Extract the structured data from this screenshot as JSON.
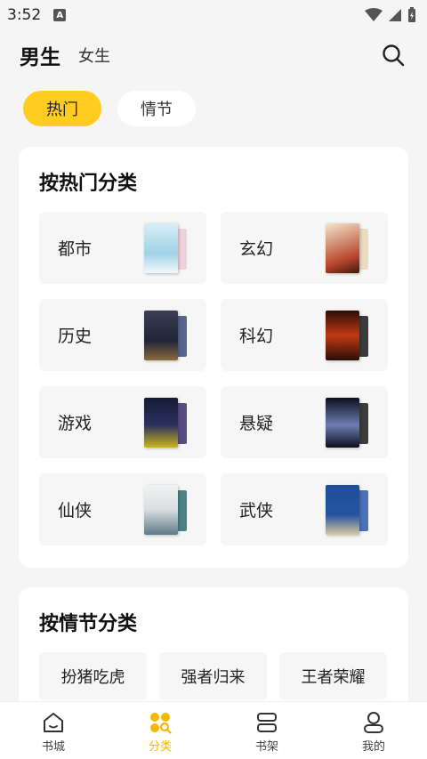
{
  "status_bar": {
    "time": "3:52",
    "notification_letter": "A"
  },
  "header": {
    "tab_male": "男生",
    "tab_female": "女生",
    "search_icon": "search-icon"
  },
  "filters": [
    {
      "label": "热门",
      "active": true
    },
    {
      "label": "情节",
      "active": false
    }
  ],
  "hot_section": {
    "title": "按热门分类",
    "categories": [
      {
        "label": "都市",
        "cover_colors": [
          "#9fd3e6",
          "#f1c9d6"
        ]
      },
      {
        "label": "玄幻",
        "cover_colors": [
          "#e8d6b8",
          "#b9462d"
        ]
      },
      {
        "label": "历史",
        "cover_colors": [
          "#1f2438",
          "#3b4a7a"
        ]
      },
      {
        "label": "科幻",
        "cover_colors": [
          "#2a0e08",
          "#c23a12"
        ]
      },
      {
        "label": "游戏",
        "cover_colors": [
          "#151a33",
          "#3c2d70"
        ]
      },
      {
        "label": "悬疑",
        "cover_colors": [
          "#0b0e1d",
          "#6c7fb3"
        ]
      },
      {
        "label": "仙侠",
        "cover_colors": [
          "#e9ecef",
          "#2e6d73"
        ]
      },
      {
        "label": "武侠",
        "cover_colors": [
          "#1f4f99",
          "#2b5bb0"
        ]
      }
    ]
  },
  "plot_section": {
    "title": "按情节分类",
    "tags": [
      "扮猪吃虎",
      "强者归来",
      "王者荣耀"
    ]
  },
  "bottom_nav": [
    {
      "label": "书城",
      "icon": "home-icon",
      "active": false
    },
    {
      "label": "分类",
      "icon": "category-icon",
      "active": true
    },
    {
      "label": "书架",
      "icon": "bookshelf-icon",
      "active": false
    },
    {
      "label": "我的",
      "icon": "profile-icon",
      "active": false
    }
  ],
  "colors": {
    "accent": "#ffcc1f",
    "active_nav": "#f5b800"
  }
}
